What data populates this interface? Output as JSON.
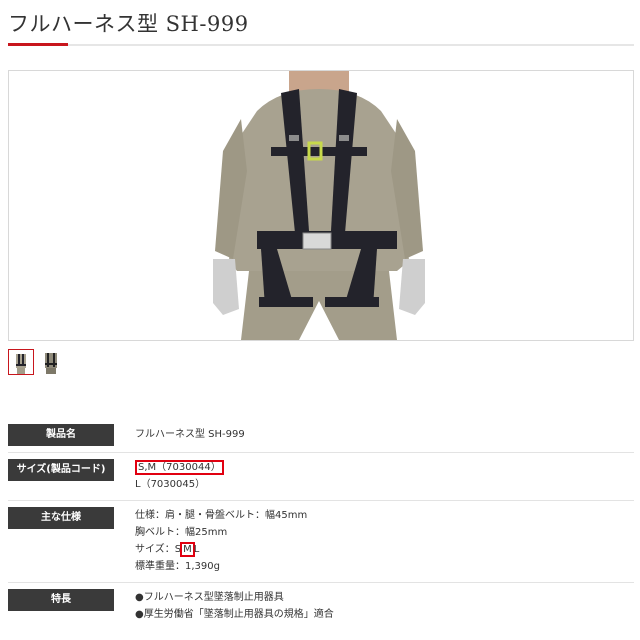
{
  "page": {
    "title": "フルハーネス型 SH-999"
  },
  "gallery": {
    "main_image": "product-photo-harness",
    "thumbnails": [
      {
        "name": "harness-front",
        "selected": true
      },
      {
        "name": "harness-worn",
        "selected": false
      }
    ]
  },
  "specs": {
    "product_name": {
      "label": "製品名",
      "value": "フルハーネス型 SH-999"
    },
    "size_code": {
      "label": "サイズ(製品コード)",
      "line1": "S,M（7030044）",
      "line2": "L（7030045）"
    },
    "main_spec": {
      "label": "主な仕様",
      "line1": "仕様：肩・腿・骨盤ベルト：幅45mm",
      "line2": "胸ベルト：幅25mm",
      "line3_prefix": "サイズ：S",
      "line3_highlight": "M",
      "line3_suffix": "L",
      "line4": "標準重量：1,390g"
    },
    "features": {
      "label": "特長",
      "line1": "●フルハーネス型墜落制止用器具",
      "line2": "●厚生労働省「墜落制止用器具の規格」適合"
    }
  },
  "colors": {
    "accent": "#c8161d",
    "label_bg": "#3a3a3a",
    "highlight": "#e10010"
  }
}
